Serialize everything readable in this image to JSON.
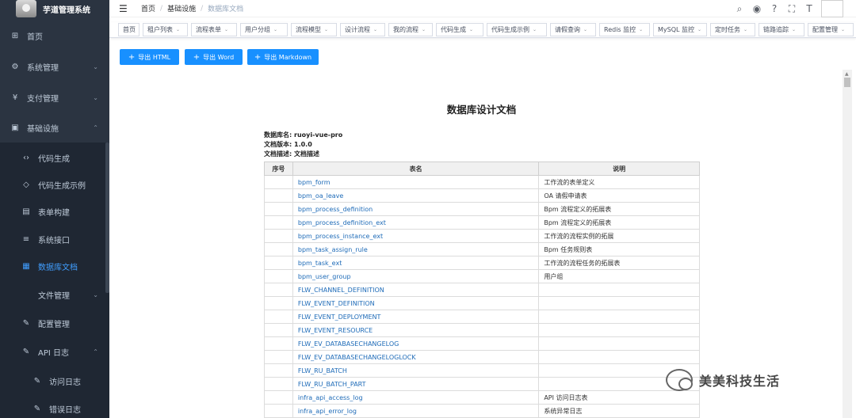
{
  "app": {
    "title": "芋道管理系统"
  },
  "sidebar": {
    "items": [
      {
        "label": "首页",
        "icon": "dashboard-icon",
        "glyph": "⊞",
        "arrow": ""
      },
      {
        "label": "系统管理",
        "icon": "gear-icon",
        "glyph": "⚙",
        "arrow": "⌄"
      },
      {
        "label": "支付管理",
        "icon": "yen-icon",
        "glyph": "¥",
        "arrow": "⌄"
      },
      {
        "label": "基础设施",
        "icon": "monitor-icon",
        "glyph": "▣",
        "arrow": "⌃"
      },
      {
        "label": "代码生成",
        "icon": "code-icon",
        "glyph": "‹›",
        "arrow": ""
      },
      {
        "label": "代码生成示例",
        "icon": "shield-icon",
        "glyph": "◇",
        "arrow": ""
      },
      {
        "label": "表单构建",
        "icon": "form-icon",
        "glyph": "▤",
        "arrow": ""
      },
      {
        "label": "系统接口",
        "icon": "sliders-icon",
        "glyph": "≡",
        "arrow": ""
      },
      {
        "label": "数据库文档",
        "icon": "table-icon",
        "glyph": "▦",
        "arrow": ""
      },
      {
        "label": "文件管理",
        "icon": "folder-icon",
        "glyph": "",
        "arrow": "⌄"
      },
      {
        "label": "配置管理",
        "icon": "edit-icon",
        "glyph": "✎",
        "arrow": ""
      },
      {
        "label": "API 日志",
        "icon": "edit-icon",
        "glyph": "✎",
        "arrow": "⌃"
      },
      {
        "label": "访问日志",
        "icon": "edit-icon",
        "glyph": "✎",
        "arrow": ""
      },
      {
        "label": "错误日志",
        "icon": "edit-icon",
        "glyph": "✎",
        "arrow": ""
      }
    ]
  },
  "navbar": {
    "breadcrumb": [
      "首页",
      "基础设施",
      "数据库文档"
    ],
    "icons": [
      "search-icon",
      "github-icon",
      "help-icon",
      "fullscreen-icon",
      "font-size-icon"
    ]
  },
  "tags": [
    {
      "label": "首页"
    },
    {
      "label": "租户列表"
    },
    {
      "label": "流程表单"
    },
    {
      "label": "用户分组"
    },
    {
      "label": "流程模型"
    },
    {
      "label": "设计流程"
    },
    {
      "label": "我的流程"
    },
    {
      "label": "代码生成"
    },
    {
      "label": "代码生成示例"
    },
    {
      "label": "请假查询"
    },
    {
      "label": "Redis 监控"
    },
    {
      "label": "MySQL 监控"
    },
    {
      "label": "定时任务"
    },
    {
      "label": "链路追踪"
    },
    {
      "label": "配置管理"
    }
  ],
  "toolbar": {
    "export_html": "导出 HTML",
    "export_word": "导出 Word",
    "export_markdown": "导出 Markdown"
  },
  "doc": {
    "title": "数据库设计文档",
    "db_name_label": "数据库名:",
    "db_name": "ruoyi-vue-pro",
    "version_label": "文档版本:",
    "version": "1.0.0",
    "desc_label": "文档描述:",
    "desc": "文档描述",
    "headers": [
      "序号",
      "表名",
      "说明"
    ],
    "rows": [
      {
        "name": "bpm_form",
        "desc": "工作流的表单定义"
      },
      {
        "name": "bpm_oa_leave",
        "desc": "OA 请假申请表"
      },
      {
        "name": "bpm_process_definition",
        "desc": "Bpm 流程定义的拓展表"
      },
      {
        "name": "bpm_process_definition_ext",
        "desc": "Bpm 流程定义的拓展表"
      },
      {
        "name": "bpm_process_instance_ext",
        "desc": "工作流的流程实例的拓展"
      },
      {
        "name": "bpm_task_assign_rule",
        "desc": "Bpm 任务规则表"
      },
      {
        "name": "bpm_task_ext",
        "desc": "工作流的流程任务的拓展表"
      },
      {
        "name": "bpm_user_group",
        "desc": "用户组"
      },
      {
        "name": "FLW_CHANNEL_DEFINITION",
        "desc": ""
      },
      {
        "name": "FLW_EVENT_DEFINITION",
        "desc": ""
      },
      {
        "name": "FLW_EVENT_DEPLOYMENT",
        "desc": ""
      },
      {
        "name": "FLW_EVENT_RESOURCE",
        "desc": ""
      },
      {
        "name": "FLW_EV_DATABASECHANGELOG",
        "desc": ""
      },
      {
        "name": "FLW_EV_DATABASECHANGELOGLOCK",
        "desc": ""
      },
      {
        "name": "FLW_RU_BATCH",
        "desc": ""
      },
      {
        "name": "FLW_RU_BATCH_PART",
        "desc": ""
      },
      {
        "name": "infra_api_access_log",
        "desc": "API 访问日志表"
      },
      {
        "name": "infra_api_error_log",
        "desc": "系统异常日志"
      }
    ]
  },
  "watermark": {
    "text": "美美科技生活"
  },
  "colors": {
    "sidebar_bg": "#2b3441",
    "submenu_bg": "#1f2733",
    "accent": "#409eff",
    "button": "#1890ff",
    "link": "#1e6bb8"
  }
}
